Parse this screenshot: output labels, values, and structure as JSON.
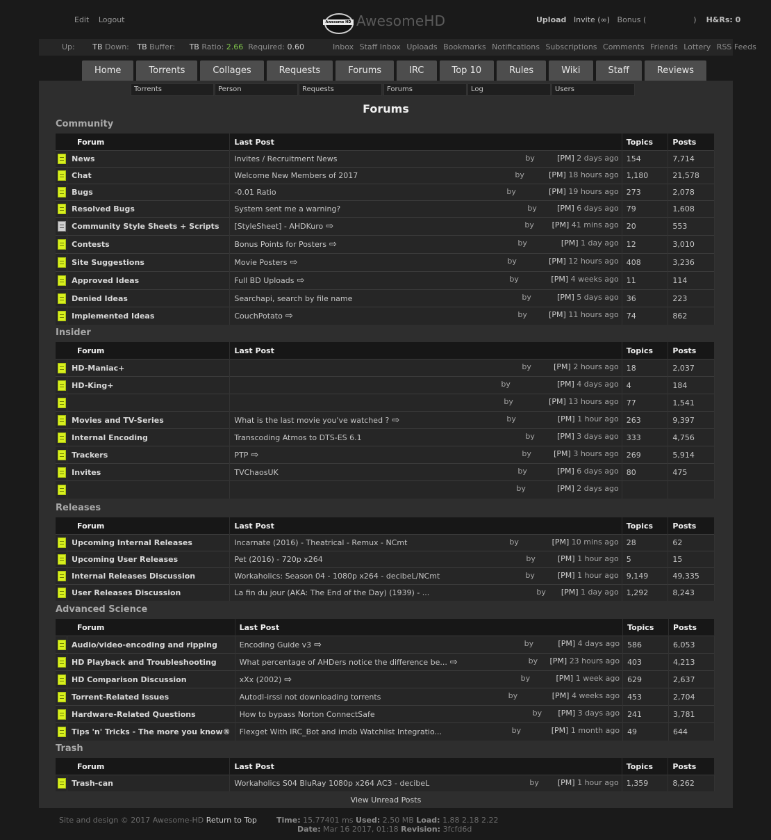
{
  "header": {
    "edit": "Edit",
    "logout": "Logout",
    "site_name": "AwesomeHD",
    "logo_badge": "Awesome HD",
    "upload": "Upload",
    "invite": "Invite (∞)",
    "bonus": "Bonus (",
    "bonus_close": ")",
    "hnr": "H&Rs: 0"
  },
  "stats": {
    "up_label": "Up:",
    "up_unit": "TB",
    "down_label": "Down:",
    "down_unit": "TB",
    "buffer_label": "Buffer:",
    "buffer_unit": "TB",
    "ratio_label": "Ratio:",
    "ratio": "2.66",
    "required_label": "Required:",
    "required": "0.60",
    "links": [
      "Inbox",
      "Staff Inbox",
      "Uploads",
      "Bookmarks",
      "Notifications",
      "Subscriptions",
      "Comments",
      "Friends",
      "Lottery",
      "RSS Feeds"
    ]
  },
  "tabs": [
    "Home",
    "Torrents",
    "Collages",
    "Requests",
    "Forums",
    "IRC",
    "Top 10",
    "Rules",
    "Wiki",
    "Staff",
    "Reviews"
  ],
  "search": [
    "Torrents",
    "Person",
    "Requests",
    "Forums",
    "Log",
    "Users"
  ],
  "page_title": "Forums",
  "columns": {
    "forum": "Forum",
    "last_post": "Last Post",
    "topics": "Topics",
    "posts": "Posts"
  },
  "categories": [
    {
      "name": "Community",
      "rows": [
        {
          "forum": "News",
          "post": "Invites / Recruitment News",
          "arrow": false,
          "when": "2 days ago",
          "topics": "154",
          "posts": "7,714"
        },
        {
          "forum": "Chat",
          "post": "Welcome New Members of 2017",
          "arrow": false,
          "when": "18 hours ago",
          "topics": "1,180",
          "posts": "21,578"
        },
        {
          "forum": "Bugs",
          "post": "-0.01 Ratio",
          "arrow": false,
          "when": "19 hours ago",
          "topics": "273",
          "posts": "2,078"
        },
        {
          "forum": "Resolved Bugs",
          "post": "System sent me a warning?",
          "arrow": false,
          "when": "6 days ago",
          "topics": "79",
          "posts": "1,608"
        },
        {
          "forum": "Community Style Sheets + Scripts",
          "post": "[StyleSheet] - AHDKuro",
          "arrow": true,
          "when": "41 mins ago",
          "topics": "20",
          "posts": "553",
          "grey": true
        },
        {
          "forum": "Contests",
          "post": "Bonus Points for Posters",
          "arrow": true,
          "when": "1 day ago",
          "topics": "12",
          "posts": "3,010"
        },
        {
          "forum": "Site Suggestions",
          "post": "Movie Posters",
          "arrow": true,
          "when": "12 hours ago",
          "topics": "408",
          "posts": "3,236"
        },
        {
          "forum": "Approved Ideas",
          "post": "Full BD Uploads",
          "arrow": true,
          "when": "4 weeks ago",
          "topics": "11",
          "posts": "114"
        },
        {
          "forum": "Denied Ideas",
          "post": "Searchapi, search by file name",
          "arrow": false,
          "when": "5 days ago",
          "topics": "36",
          "posts": "223"
        },
        {
          "forum": "Implemented Ideas",
          "post": "CouchPotato",
          "arrow": true,
          "when": "11 hours ago",
          "topics": "74",
          "posts": "862"
        }
      ]
    },
    {
      "name": "Insider",
      "rows": [
        {
          "forum": "HD-Maniac+",
          "post": "",
          "arrow": false,
          "when": "2 hours ago",
          "topics": "18",
          "posts": "2,037"
        },
        {
          "forum": "HD-King+",
          "post": "",
          "arrow": false,
          "when": "4 days ago",
          "topics": "4",
          "posts": "184"
        },
        {
          "forum": "",
          "post": "",
          "arrow": false,
          "when": "13 hours ago",
          "topics": "77",
          "posts": "1,541"
        },
        {
          "forum": "Movies and TV-Series",
          "post": "What is the last movie you've watched ?",
          "arrow": true,
          "when": "1 hour ago",
          "topics": "263",
          "posts": "9,397"
        },
        {
          "forum": "Internal Encoding",
          "post": "Transcoding Atmos to DTS-ES 6.1",
          "arrow": false,
          "when": "3 days ago",
          "topics": "333",
          "posts": "4,756"
        },
        {
          "forum": "Trackers",
          "post": "PTP",
          "arrow": true,
          "when": "3 hours ago",
          "topics": "269",
          "posts": "5,914"
        },
        {
          "forum": "Invites",
          "post": "TVChaosUK",
          "arrow": false,
          "when": "6 days ago",
          "topics": "80",
          "posts": "475"
        },
        {
          "forum": "",
          "post": "",
          "arrow": false,
          "when": "2 days ago",
          "topics": "",
          "posts": ""
        }
      ]
    },
    {
      "name": "Releases",
      "rows": [
        {
          "forum": "Upcoming Internal Releases",
          "post": "Incarnate (2016) - Theatrical - Remux - NCmt",
          "arrow": false,
          "when": "10 mins ago",
          "topics": "28",
          "posts": "62"
        },
        {
          "forum": "Upcoming User Releases",
          "post": "Pet (2016) - 720p x264",
          "arrow": false,
          "when": "1 hour ago",
          "topics": "5",
          "posts": "15"
        },
        {
          "forum": "Internal Releases Discussion",
          "post": "Workaholics: Season 04 - 1080p x264 - decibeL/NCmt",
          "arrow": false,
          "when": "1 hour ago",
          "topics": "9,149",
          "posts": "49,335"
        },
        {
          "forum": "User Releases Discussion",
          "post": "La fin du jour (AKA: The End of the Day) (1939) - ...",
          "arrow": false,
          "when": "1 day ago",
          "topics": "1,292",
          "posts": "8,243"
        }
      ]
    },
    {
      "name": "Advanced Science",
      "rows": [
        {
          "forum": "Audio/video-encoding and ripping",
          "post": "Encoding Guide v3",
          "arrow": true,
          "when": "4 days ago",
          "topics": "586",
          "posts": "6,053"
        },
        {
          "forum": "HD Playback and Troubleshooting",
          "post": "What percentage of AHDers notice the difference be...",
          "arrow": true,
          "when": "23 hours ago",
          "topics": "403",
          "posts": "4,213"
        },
        {
          "forum": "HD Comparison Discussion",
          "post": "xXx (2002)",
          "arrow": true,
          "when": "1 week ago",
          "topics": "629",
          "posts": "2,637"
        },
        {
          "forum": "Torrent-Related Issues",
          "post": "Autodl-irssi not downloading torrents",
          "arrow": false,
          "when": "4 weeks ago",
          "topics": "453",
          "posts": "2,704"
        },
        {
          "forum": "Hardware-Related Questions",
          "post": "How to bypass Norton ConnectSafe",
          "arrow": false,
          "when": "3 days ago",
          "topics": "241",
          "posts": "3,781"
        },
        {
          "forum": "Tips 'n' Tricks - The more you know®",
          "post": "Flexget With IRC_Bot and imdb Watchlist Integratio...",
          "arrow": false,
          "when": "1 month ago",
          "topics": "49",
          "posts": "644"
        }
      ]
    },
    {
      "name": "Trash",
      "rows": [
        {
          "forum": "Trash-can",
          "post": "Workaholics S04 BluRay 1080p x264 AC3 - decibeL",
          "arrow": false,
          "when": "1 hour ago",
          "topics": "1,359",
          "posts": "8,262"
        }
      ]
    }
  ],
  "by": "by",
  "pm": "[PM]",
  "view_unread": "View Unread Posts",
  "footer": {
    "copyright": "Site and design © 2017 Awesome-HD",
    "top": "Return to Top",
    "time_label": "Time:",
    "time": "15.77401 ms",
    "used_label": "Used:",
    "used": "2.50 MB",
    "load_label": "Load:",
    "load": "1.88 2.18 2.22",
    "date_label": "Date:",
    "date": "Mar 16 2017, 01:18",
    "rev_label": "Revision:",
    "rev": "3fcfd6d"
  },
  "colors": {
    "ratio": "#7ec44a",
    "forum_icon": "#d8f01e"
  }
}
